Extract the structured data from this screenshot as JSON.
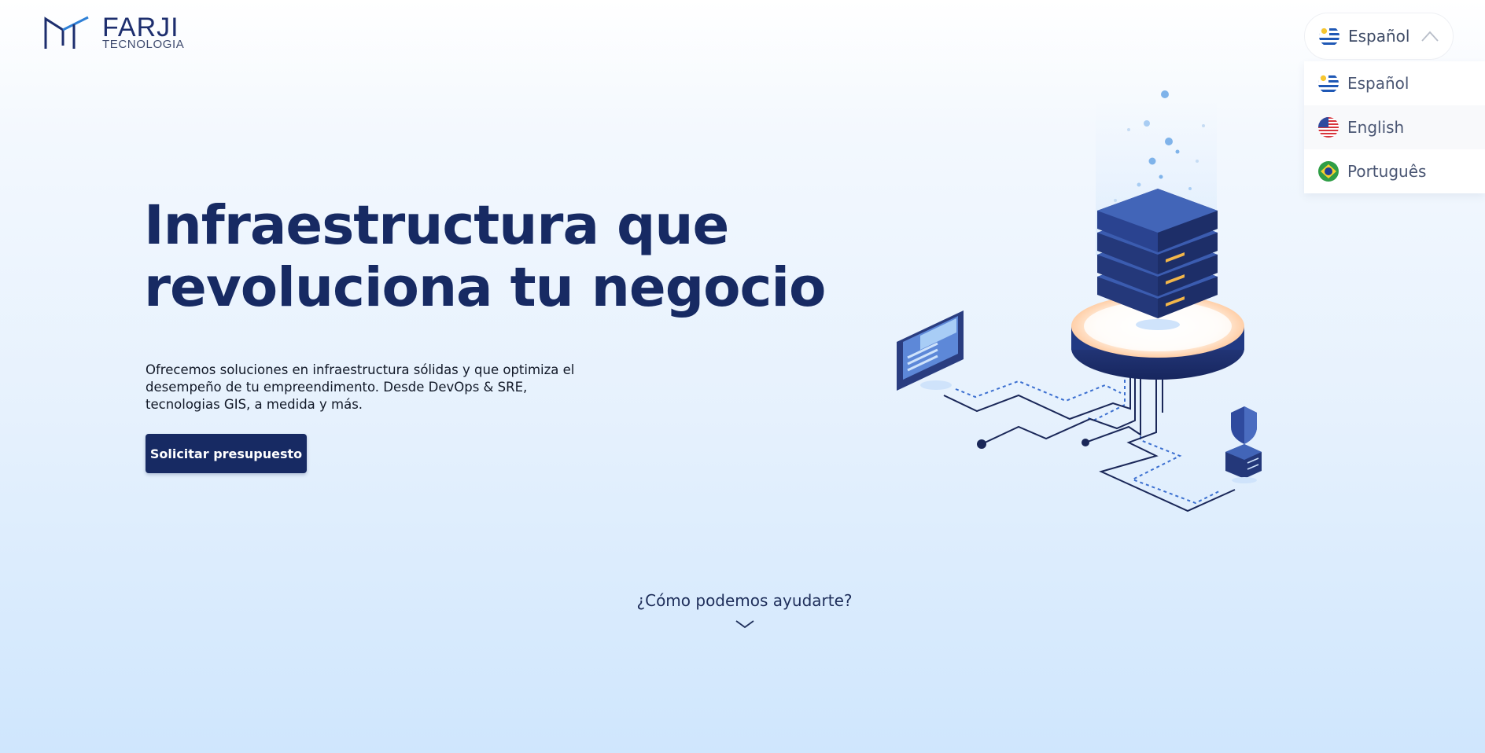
{
  "brand": {
    "name": "FARJI",
    "subtitle": "TECNOLOGIA",
    "logo_icon": "farji-logo-mark"
  },
  "language": {
    "selected": "Español",
    "expanded": true,
    "options": [
      {
        "label": "Español",
        "flag": "uruguay-flag-icon"
      },
      {
        "label": "English",
        "flag": "usa-flag-icon"
      },
      {
        "label": "Português",
        "flag": "brazil-flag-icon"
      }
    ]
  },
  "hero": {
    "title_line1": "Infraestructura que",
    "title_line2": "revoluciona tu negocio",
    "description": "Ofrecemos soluciones en infraestructura sólidas y que optimiza el desempeño de tu empreendimento. Desde DevOps & SRE, tecnologias GIS, a medida y más.",
    "cta_label": "Solicitar presupuesto"
  },
  "help": {
    "label": "¿Cómo podemos ayudarte?"
  },
  "colors": {
    "primary": "#172a63",
    "background_top": "#ffffff",
    "background_bottom": "#cfe6fd"
  }
}
